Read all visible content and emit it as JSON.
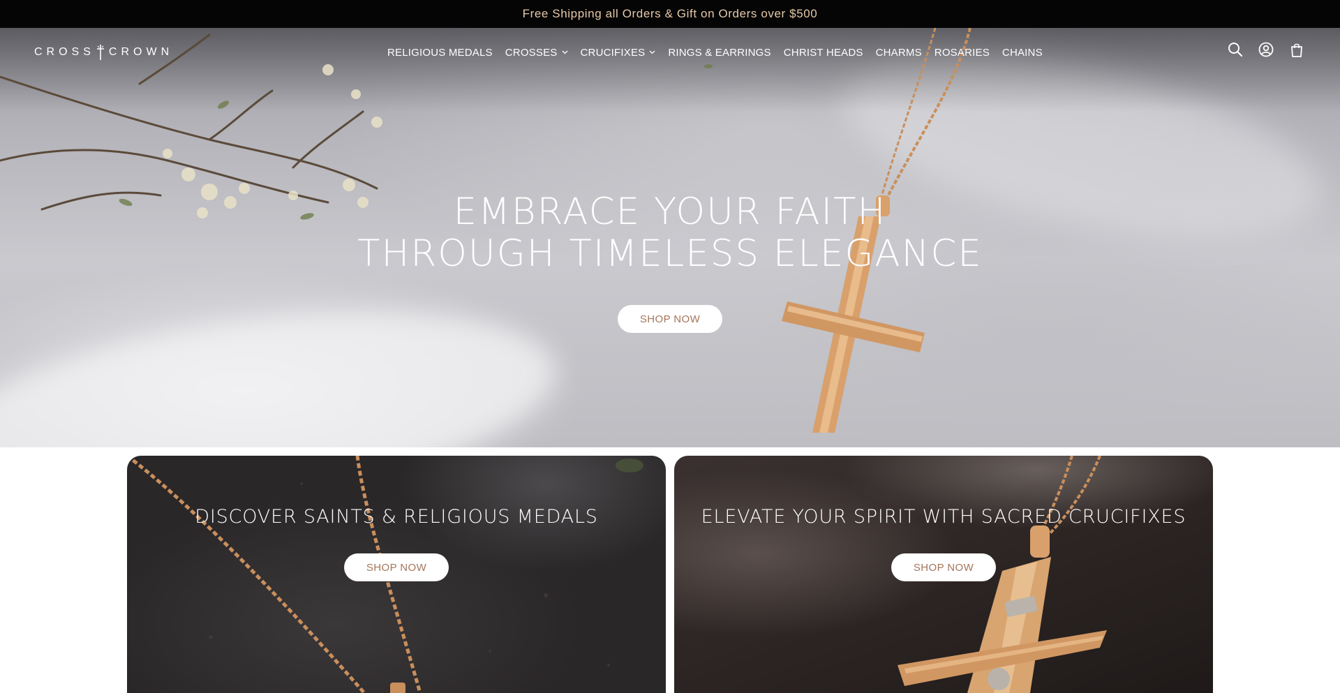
{
  "announcement": {
    "text": "Free Shipping all Orders & Gift on Orders over $500"
  },
  "header": {
    "logo": {
      "left": "CROSS",
      "right": "CROWN"
    },
    "nav": [
      {
        "label": "RELIGIOUS MEDALS",
        "has_dropdown": false
      },
      {
        "label": "CROSSES",
        "has_dropdown": true
      },
      {
        "label": "CRUCIFIXES",
        "has_dropdown": true
      },
      {
        "label": "RINGS & EARRINGS",
        "has_dropdown": false
      },
      {
        "label": "CHRIST HEADS",
        "has_dropdown": false
      },
      {
        "label": "CHARMS",
        "has_dropdown": false
      },
      {
        "label": "ROSARIES",
        "has_dropdown": false
      },
      {
        "label": "CHAINS",
        "has_dropdown": false
      }
    ],
    "icons": [
      "search-icon",
      "account-icon",
      "cart-icon"
    ]
  },
  "hero": {
    "title_line1": "EMBRACE YOUR FAITH",
    "title_line2": "THROUGH TIMELESS ELEGANCE",
    "button": "SHOP NOW"
  },
  "cards": [
    {
      "title": "DISCOVER SAINTS & RELIGIOUS MEDALS",
      "button": "SHOP NOW"
    },
    {
      "title": "ELEVATE YOUR SPIRIT WITH SACRED CRUCIFIXES",
      "button": "SHOP NOW"
    }
  ],
  "colors": {
    "announcement_bg": "#050505",
    "announcement_text": "#e6c9a8",
    "button_text": "#a4765a",
    "gold": "#d7a06a"
  }
}
